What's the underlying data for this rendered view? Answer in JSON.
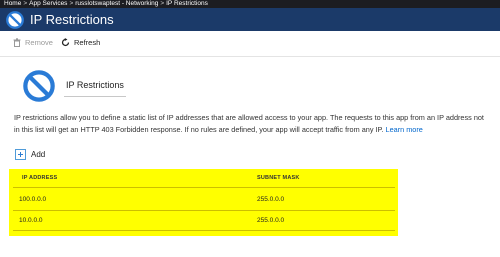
{
  "breadcrumb": {
    "items": [
      "Home",
      "App Services",
      "russlotswaptest - Networking",
      "IP Restrictions"
    ],
    "separator": ">"
  },
  "header": {
    "title": "IP Restrictions",
    "icon": "no-entry-icon"
  },
  "toolbar": {
    "remove_label": "Remove",
    "refresh_label": "Refresh"
  },
  "content": {
    "title": "IP Restrictions",
    "description": "IP restrictions allow you to define a static list of IP addresses that are allowed access to your app. The requests to this app from an IP address not in this list will get an HTTP 403 Forbidden response. If no rules are defined, your app will accept traffic from any IP.",
    "learn_more_label": "Learn more",
    "add_label": "Add"
  },
  "table": {
    "columns": [
      "IP ADDRESS",
      "SUBNET MASK"
    ],
    "rows": [
      [
        "100.0.0.0",
        "255.0.0.0"
      ],
      [
        "10.0.0.0",
        "255.0.0.0"
      ]
    ]
  },
  "colors": {
    "header_bg": "#1b3a69",
    "breadcrumb_bg": "#1c1d22",
    "highlight": "#ffff00",
    "icon_accent": "#2a7bd6",
    "link": "#0066cc"
  }
}
